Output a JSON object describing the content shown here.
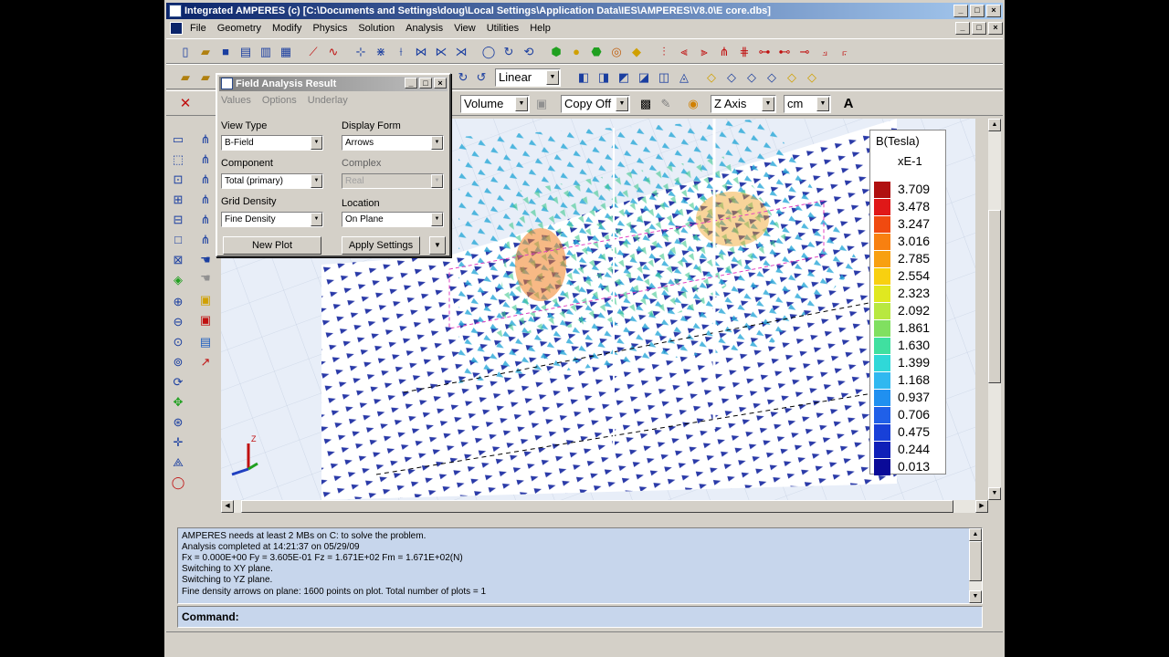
{
  "window": {
    "title": "Integrated AMPERES (c)   [C:\\Documents and Settings\\doug\\Local Settings\\Application Data\\IES\\AMPERES\\V8.0\\E core.dbs]",
    "min": "_",
    "max": "□",
    "close": "×"
  },
  "menu": {
    "items": [
      "File",
      "Geometry",
      "Modify",
      "Physics",
      "Solution",
      "Analysis",
      "View",
      "Utilities",
      "Help"
    ]
  },
  "toolbar": {
    "mode_combo": "Linear",
    "render_combo": "Volume",
    "copy_combo": "Copy Off",
    "axis_combo": "Z Axis",
    "unit_combo": "cm",
    "text_button": "A",
    "close_x": "✕"
  },
  "dialog": {
    "title": "Field Analysis Result",
    "tabs": [
      "Values",
      "Options",
      "Underlay"
    ],
    "view_type_label": "View Type",
    "view_type_value": "B-Field",
    "display_form_label": "Display Form",
    "display_form_value": "Arrows",
    "component_label": "Component",
    "component_value": "Total (primary)",
    "complex_label": "Complex",
    "complex_value": "Real",
    "grid_density_label": "Grid Density",
    "grid_density_value": "Fine Density",
    "location_label": "Location",
    "location_value": "On Plane",
    "new_plot_button": "New Plot",
    "apply_button": "Apply Settings",
    "more_button": "▼"
  },
  "legend": {
    "title": "B(Tesla)",
    "multiplier": "xE-1",
    "entries": [
      {
        "value": "3.709",
        "color": "#b01010"
      },
      {
        "value": "3.478",
        "color": "#e01818"
      },
      {
        "value": "3.247",
        "color": "#f04a10"
      },
      {
        "value": "3.016",
        "color": "#f88010"
      },
      {
        "value": "2.785",
        "color": "#f8a010"
      },
      {
        "value": "2.554",
        "color": "#f8d010"
      },
      {
        "value": "2.323",
        "color": "#e0e820"
      },
      {
        "value": "2.092",
        "color": "#b8e840"
      },
      {
        "value": "1.861",
        "color": "#80e060"
      },
      {
        "value": "1.630",
        "color": "#40e0a0"
      },
      {
        "value": "1.399",
        "color": "#30d8d8"
      },
      {
        "value": "1.168",
        "color": "#30b8f0"
      },
      {
        "value": "0.937",
        "color": "#2090f0"
      },
      {
        "value": "0.706",
        "color": "#2060e8"
      },
      {
        "value": "0.475",
        "color": "#1840d8"
      },
      {
        "value": "0.244",
        "color": "#1020b8"
      },
      {
        "value": "0.013",
        "color": "#0a0a98"
      }
    ]
  },
  "console": {
    "lines": [
      "AMPERES needs at least 2 MBs on C: to solve the problem.",
      "Analysis completed at 14:21:37 on 05/29/09",
      "Fx = 0.000E+00   Fy = 3.605E-01   Fz = 1.671E+02   Fm = 1.671E+02(N)",
      "Switching to XY plane.",
      "Switching to YZ plane.",
      "Fine density arrows on plane: 1600 points on plot.   Total number of plots = 1"
    ],
    "command_label": "Command:"
  },
  "axis_triad": {
    "z": "Z"
  }
}
